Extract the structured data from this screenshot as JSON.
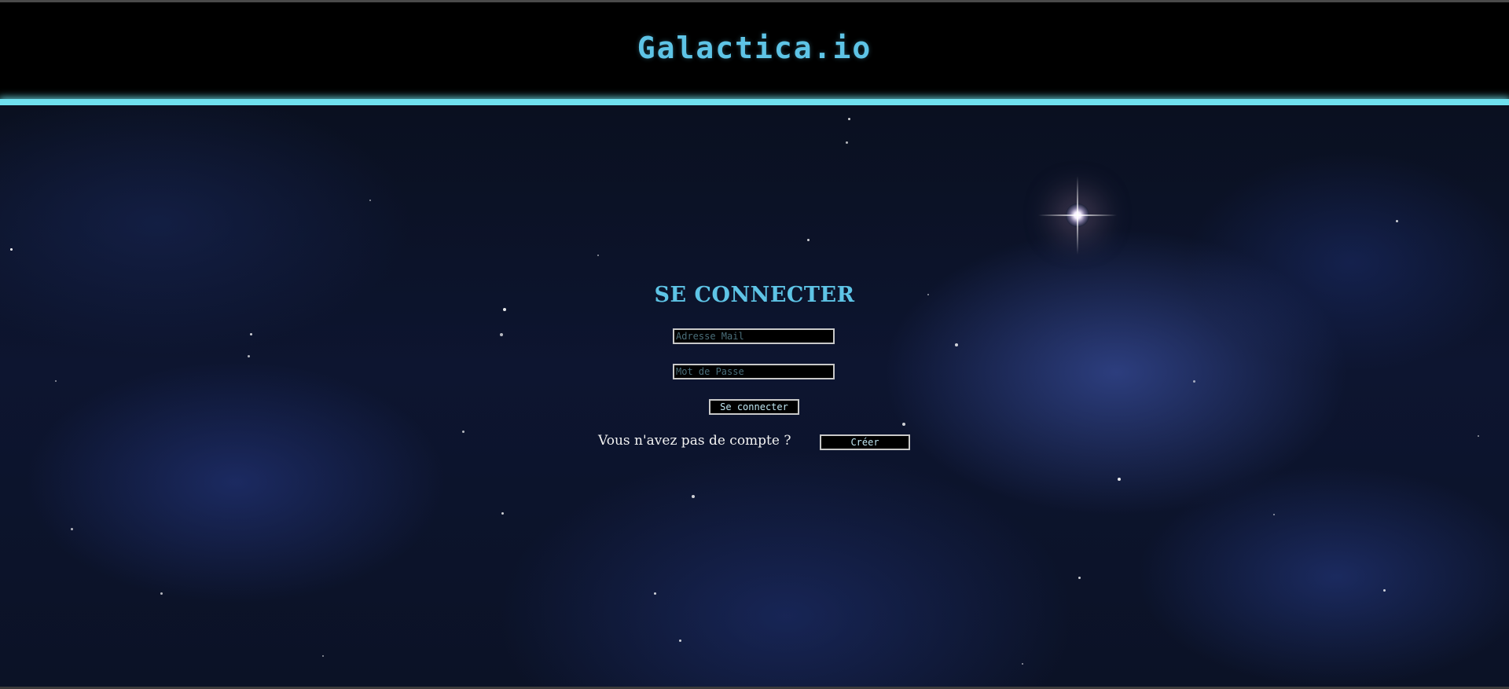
{
  "header": {
    "brand": "Galactica.io"
  },
  "login": {
    "title": "SE CONNECTER",
    "email_placeholder": "Adresse Mail",
    "email_value": "",
    "password_placeholder": "Mot de Passe",
    "password_value": "",
    "submit_label": "Se connecter",
    "signup_prompt": "Vous n'avez pas de compte ?",
    "signup_button_label": "Créer"
  },
  "colors": {
    "accent": "#5ec4e6",
    "glow_bar": "#6fe0ee",
    "header_bg": "#000000",
    "field_border": "#c8c8c8",
    "text_light": "#f2f2f2"
  }
}
